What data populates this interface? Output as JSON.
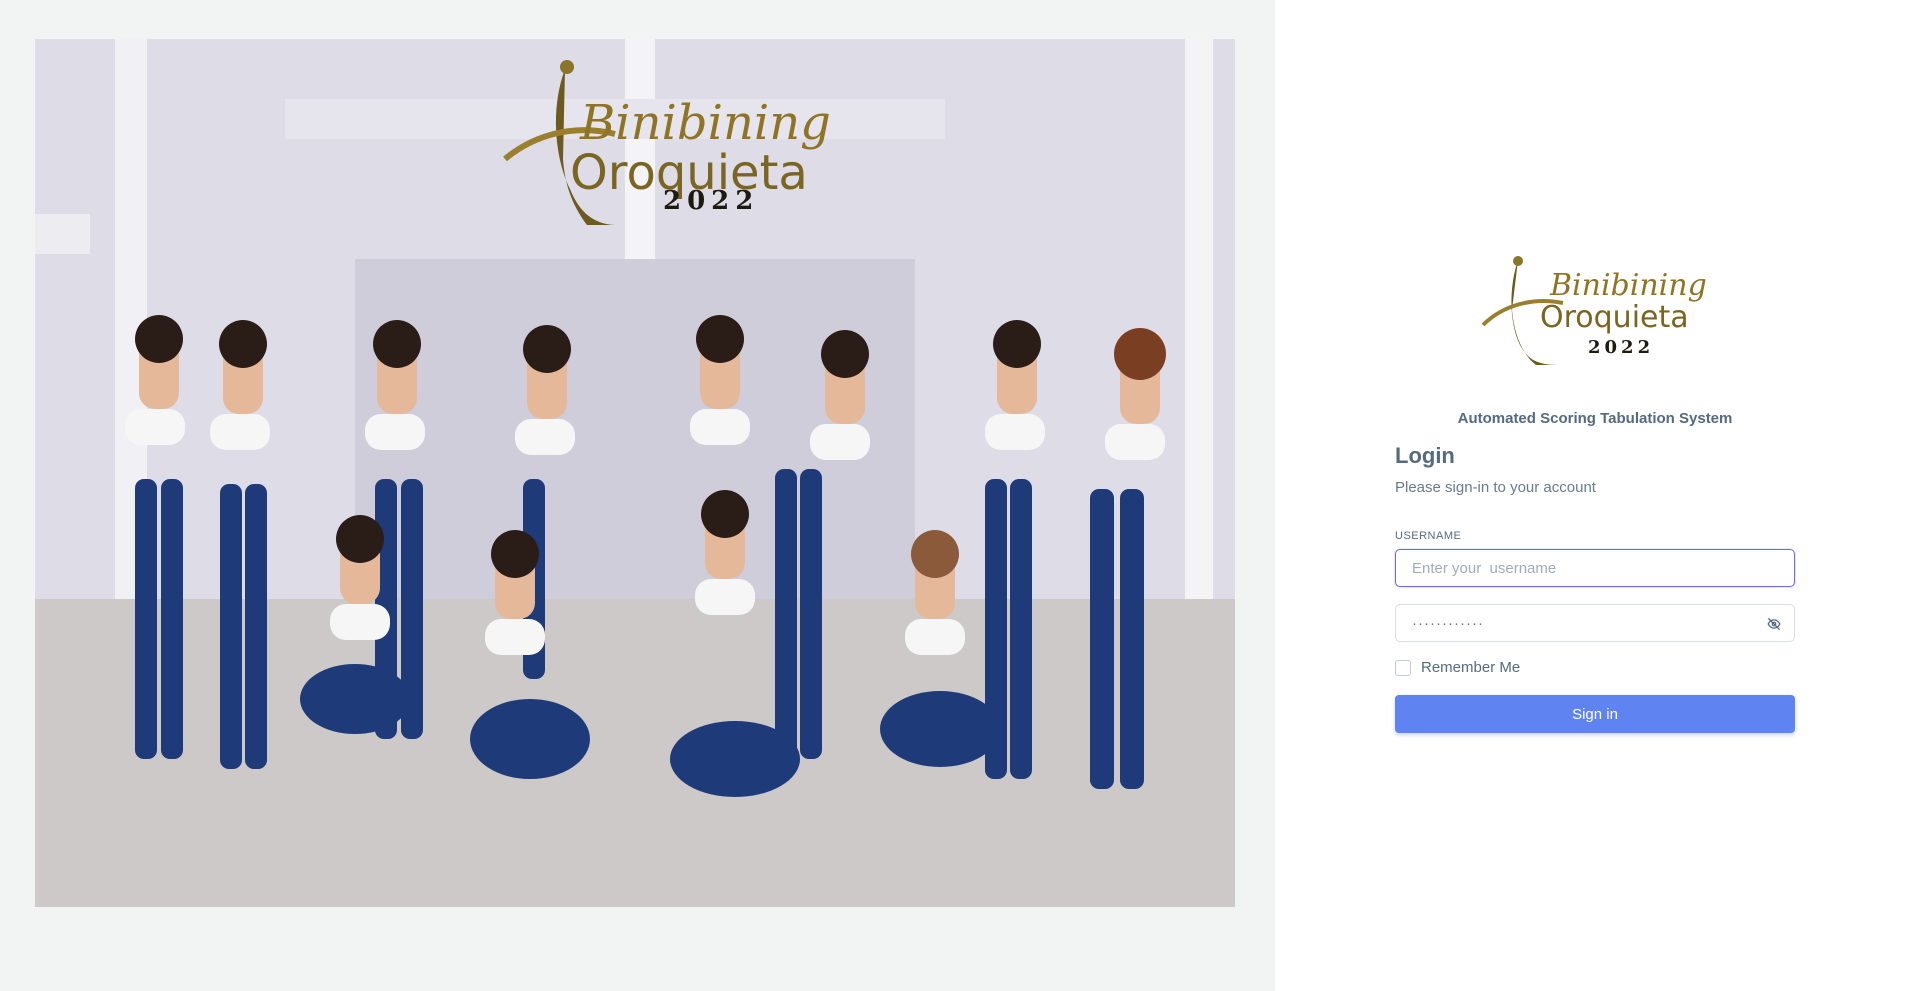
{
  "hero": {
    "logo_script": "Binibining",
    "logo_name": "Oroquieta",
    "logo_year": "2022"
  },
  "auth": {
    "logo_script": "Binibining",
    "logo_name": "Oroquieta",
    "logo_year": "2022",
    "system_name": "Automated Scoring Tabulation System",
    "title": "Login",
    "subtitle": "Please sign-in to your account",
    "username_label": "USERNAME",
    "username_placeholder": "Enter your  username",
    "password_value": "············",
    "remember_label": "Remember Me",
    "signin_label": "Sign in"
  },
  "icons": {
    "password_toggle": "eye-off-icon"
  },
  "colors": {
    "primary": "#5f83f0",
    "text_heading": "#566a7f",
    "text_muted": "#697a8d",
    "logo_gold": "#b8962e"
  }
}
